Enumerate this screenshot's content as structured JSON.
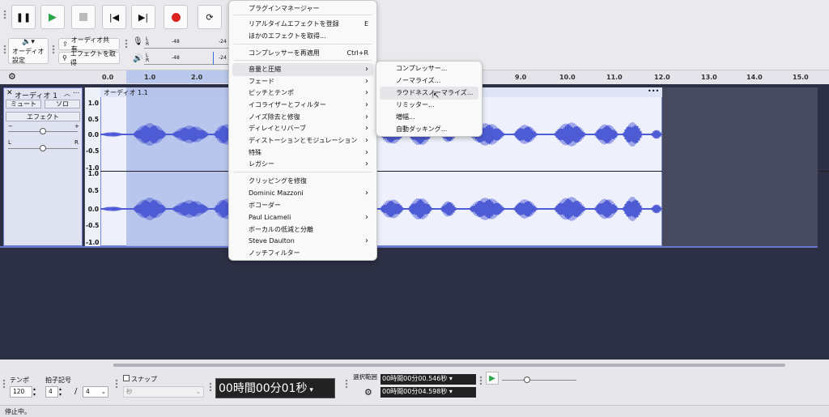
{
  "toolbar": {
    "audio_setup": "オーディオ設定",
    "share_audio": "オーディオ共有",
    "get_effects": "エフェクトを取得",
    "meter_ticks_rec": [
      "-48",
      "-24"
    ],
    "meter_ticks_play": [
      "-48",
      "-24"
    ],
    "meter_lr": [
      "L",
      "R"
    ]
  },
  "ruler": {
    "ticks": [
      "0.0",
      "1.0",
      "2.0",
      "9.0",
      "10.0",
      "11.0",
      "12.0",
      "13.0",
      "14.0",
      "15.0"
    ]
  },
  "track": {
    "name": "オーディオ 1",
    "mute": "ミュート",
    "solo": "ソロ",
    "effects": "エフェクト",
    "clip_name": "オーディオ 1.1",
    "clip_menu": "•••",
    "gain_minus": "−",
    "gain_plus": "+",
    "pan_l": "L",
    "pan_r": "R",
    "amp_labels": [
      "1.0",
      "0.5",
      "0.0",
      "-0.5",
      "-1.0",
      "1.0",
      "0.5",
      "0.0",
      "-0.5",
      "-1.0"
    ]
  },
  "menu_main": {
    "items": [
      {
        "label": "プラグインマネージャー",
        "shortcut": ""
      },
      {
        "label": "リアルタイムエフェクトを登録",
        "shortcut": "E"
      },
      {
        "label": "ほかのエフェクトを取得...",
        "shortcut": ""
      },
      {
        "label": "コンプレッサーを再適用",
        "shortcut": "Ctrl+R"
      },
      {
        "label": "音量と圧縮",
        "sub": true
      },
      {
        "label": "フェード",
        "sub": true
      },
      {
        "label": "ピッチとテンポ",
        "sub": true
      },
      {
        "label": "イコライザーとフィルター",
        "sub": true
      },
      {
        "label": "ノイズ除去と修復",
        "sub": true
      },
      {
        "label": "ディレイとリバーブ",
        "sub": true
      },
      {
        "label": "ディストーションとモジュレーション",
        "sub": true
      },
      {
        "label": "特殊",
        "sub": true
      },
      {
        "label": "レガシー",
        "sub": true
      },
      {
        "label": "クリッピングを修復",
        "sub": false
      },
      {
        "label": "Dominic Mazzoni",
        "sub": true
      },
      {
        "label": "ボコーダー",
        "sub": false
      },
      {
        "label": "Paul Licameli",
        "sub": true
      },
      {
        "label": "ボーカルの低減と分離",
        "sub": false
      },
      {
        "label": "Steve Daulton",
        "sub": true
      },
      {
        "label": "ノッチフィルター",
        "sub": false
      }
    ]
  },
  "menu_sub": {
    "items": [
      "コンプレッサー...",
      "ノーマライズ...",
      "ラウドネスノーマライズ...",
      "リミッター...",
      "増幅...",
      "自動ダッキング..."
    ]
  },
  "bottom": {
    "tempo_label": "テンポ",
    "tempo_value": "120",
    "timesig_label": "拍子記号",
    "timesig_num": "4",
    "timesig_sep": "/",
    "timesig_den": "4",
    "snap_label": "スナップ",
    "snap_unit": "秒",
    "time_display": "00時間00分01秒",
    "selection_label": "選択範囲",
    "sel_start": "00時間00分00.546秒",
    "sel_end": "00時間00分04.598秒"
  },
  "status": {
    "text": "停止中。"
  }
}
